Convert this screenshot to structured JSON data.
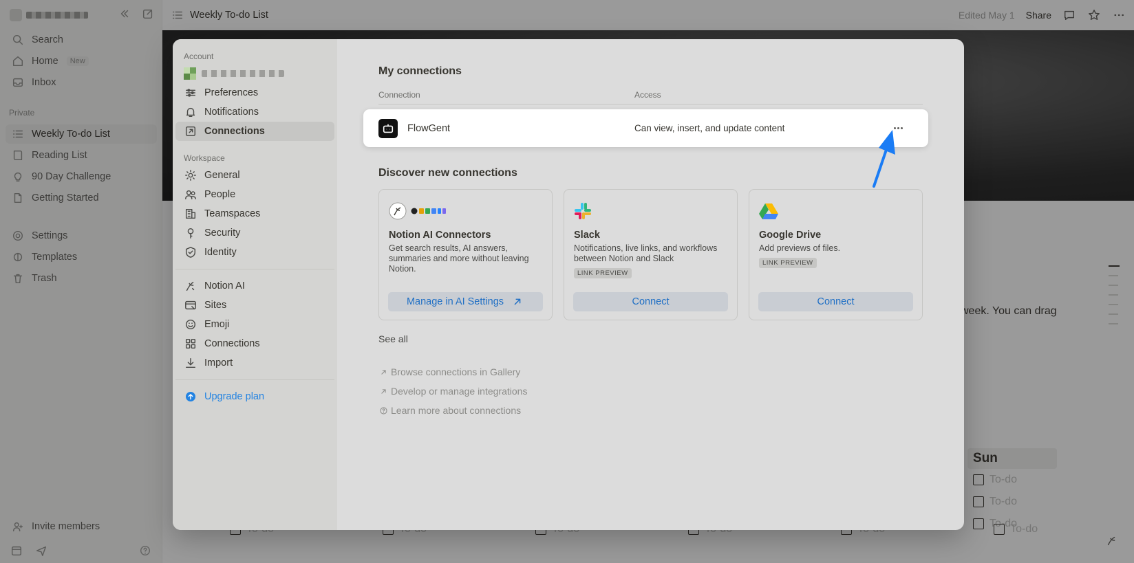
{
  "sidebar": {
    "items": [
      {
        "label": "Search",
        "icon": "search-icon"
      },
      {
        "label": "Home",
        "icon": "home-icon",
        "badge": "New"
      },
      {
        "label": "Inbox",
        "icon": "inbox-icon"
      }
    ],
    "private_label": "Private",
    "pages": [
      {
        "label": "Weekly To-do List",
        "icon": "list-icon"
      },
      {
        "label": "Reading List",
        "icon": "book-icon"
      },
      {
        "label": "90 Day Challenge",
        "icon": "bulb-icon"
      },
      {
        "label": "Getting Started",
        "icon": "page-icon"
      }
    ],
    "utilities": [
      {
        "label": "Settings",
        "icon": "gear-icon"
      },
      {
        "label": "Templates",
        "icon": "templates-icon"
      },
      {
        "label": "Trash",
        "icon": "trash-icon"
      }
    ],
    "invite_label": "Invite members"
  },
  "topbar": {
    "page_title": "Weekly To-do List",
    "edited": "Edited May 1",
    "share": "Share"
  },
  "page": {
    "body_text": "week. You can drag",
    "sun_heading": "Sun",
    "todo_placeholder": "To-do",
    "todo_short": "To-do"
  },
  "settings": {
    "nav": {
      "account_label": "Account",
      "account_items": [
        {
          "label": "Preferences",
          "icon": "sliders-icon"
        },
        {
          "label": "Notifications",
          "icon": "bell-icon"
        },
        {
          "label": "Connections",
          "icon": "external-link-box-icon"
        }
      ],
      "workspace_label": "Workspace",
      "workspace_items": [
        {
          "label": "General",
          "icon": "gear-icon"
        },
        {
          "label": "People",
          "icon": "people-icon"
        },
        {
          "label": "Teamspaces",
          "icon": "building-icon"
        },
        {
          "label": "Security",
          "icon": "key-icon"
        },
        {
          "label": "Identity",
          "icon": "shield-check-icon"
        }
      ],
      "feature_items": [
        {
          "label": "Notion AI",
          "icon": "notion-ai-icon"
        },
        {
          "label": "Sites",
          "icon": "sites-icon"
        },
        {
          "label": "Emoji",
          "icon": "smile-icon"
        },
        {
          "label": "Connections",
          "icon": "grid-icon"
        },
        {
          "label": "Import",
          "icon": "download-icon"
        }
      ],
      "upgrade_label": "Upgrade plan"
    },
    "my_connections": {
      "title": "My connections",
      "col_connection": "Connection",
      "col_access": "Access",
      "rows": [
        {
          "name": "FlowGent",
          "access": "Can view, insert, and update content"
        }
      ]
    },
    "discover": {
      "title": "Discover new connections",
      "cards": [
        {
          "title": "Notion AI Connectors",
          "desc": "Get search results, AI answers, summaries and more without leaving Notion.",
          "button": "Manage in AI Settings"
        },
        {
          "title": "Slack",
          "desc": "Notifications, live links, and workflows between Notion and Slack",
          "tag": "LINK PREVIEW",
          "button": "Connect"
        },
        {
          "title": "Google Drive",
          "desc": "Add previews of files.",
          "tag": "LINK PREVIEW",
          "button": "Connect"
        }
      ],
      "see_all": "See all",
      "links": [
        {
          "label": "Browse connections in Gallery",
          "icon": "arrow-up-right-icon"
        },
        {
          "label": "Develop or manage integrations",
          "icon": "arrow-up-right-icon"
        },
        {
          "label": "Learn more about connections",
          "icon": "help-circle-icon"
        }
      ]
    }
  },
  "colors": {
    "accent": "#2383e2",
    "annotation_arrow": "#1a7cf5"
  }
}
